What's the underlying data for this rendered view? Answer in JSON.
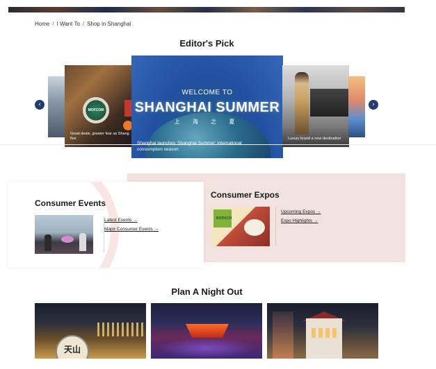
{
  "breadcrumb": {
    "home": "Home",
    "sep": "/",
    "want": "I Want To",
    "current": "Shop in Shanghai"
  },
  "editors_pick": {
    "title": "Editor's Pick",
    "slides": {
      "left_caption": "Great deals, greater fear as Shang five",
      "left_badge": "MOFCOM",
      "center_welcome": "WELCOME TO",
      "center_headline": "SHANGHAI SUMMER",
      "center_cn": "上 海 之 夏",
      "center_caption": "Shanghai launches 'Shanghai Summer' international consumption season",
      "right_caption": "Luxury brand a new destination"
    },
    "prev_glyph": "‹",
    "next_glyph": "›"
  },
  "consumer_events": {
    "title": "Consumer Events",
    "links": {
      "latest": "Latest Events →",
      "major": "Major Consumer Events →"
    }
  },
  "consumer_expos": {
    "title": "Consumer Expos",
    "thumb_text": "BIOFACH",
    "links": {
      "upcoming": "Upcoming Expos →",
      "highlights": "Expo Highlights →"
    }
  },
  "night_out": {
    "title": "Plan A Night Out",
    "sign_text": "天山"
  },
  "colors": {
    "nav_dark": "#1f3d6e",
    "expos_bg": "#f2e2e0"
  }
}
